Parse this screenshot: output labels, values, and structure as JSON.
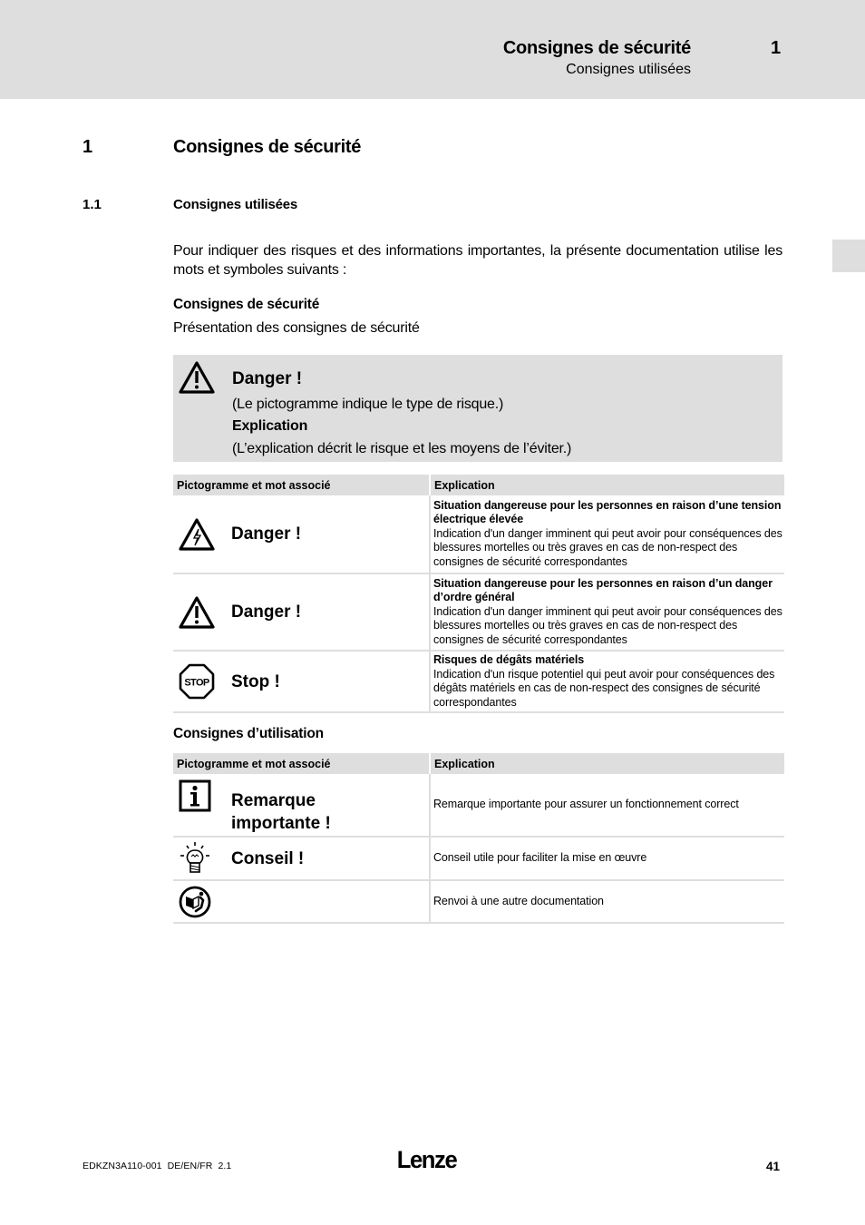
{
  "header": {
    "title": "Consignes de sécurité",
    "chapter_number": "1",
    "subtitle": "Consignes utilisées"
  },
  "section": {
    "number": "1",
    "title": "Consignes de sécurité",
    "subsection_number": "1.1",
    "subsection_title": "Consignes utilisées",
    "intro": "Pour indiquer des risques et des informations importantes, la présente documentation utilise les mots et symboles suivants :"
  },
  "safety": {
    "heading": "Consignes de sécurité",
    "description": "Présentation des consignes de sécurité",
    "example_box": {
      "icon": "warning-triangle-icon",
      "title": "Danger !",
      "line1": "(Le pictogramme indique le type de risque.)",
      "line2": "Explication",
      "line3": "(L’explication décrit le risque et les moyens de l’éviter.)"
    },
    "table": {
      "headers": [
        "Pictogramme et mot associé",
        "Explication"
      ],
      "rows": [
        {
          "icon": "electric-hazard-icon",
          "word": "Danger !",
          "title": "Situation dangereuse pour les personnes en raison d’une tension électrique élevée",
          "text": "Indication d'un danger imminent qui peut avoir pour conséquences des blessures mortelles ou très graves en cas de non-respect des consignes de sécurité correspondantes"
        },
        {
          "icon": "general-danger-icon",
          "word": "Danger !",
          "title": "Situation dangereuse pour les personnes en raison d’un danger d’ordre général",
          "text": "Indication d'un danger imminent qui peut avoir pour conséquences des blessures mortelles ou très graves en cas de non-respect des consignes de sécurité correspondantes"
        },
        {
          "icon": "stop-icon",
          "icon_text": "STOP",
          "word": "Stop !",
          "title": "Risques de dégâts matériels",
          "text": "Indication d'un risque potentiel qui peut avoir pour conséquences des dégâts matériels en cas de non-respect des consignes de sécurité correspondantes"
        }
      ]
    }
  },
  "usage": {
    "heading": "Consignes d’utilisation",
    "table": {
      "headers": [
        "Pictogramme et mot associé",
        "Explication"
      ],
      "rows": [
        {
          "icon": "info-icon",
          "word_line1": "Remarque",
          "word_line2": "importante !",
          "text": "Remarque importante pour assurer un fonctionnement correct"
        },
        {
          "icon": "lightbulb-tip-icon",
          "word": "Conseil !",
          "text": "Conseil utile pour faciliter la mise en œuvre"
        },
        {
          "icon": "reference-book-icon",
          "word": "",
          "text": "Renvoi à une autre documentation"
        }
      ]
    }
  },
  "footer": {
    "doc_code": "EDKZN3A110-001  DE/EN/FR  2.1",
    "logo": "Lenze",
    "page_number": "41"
  }
}
